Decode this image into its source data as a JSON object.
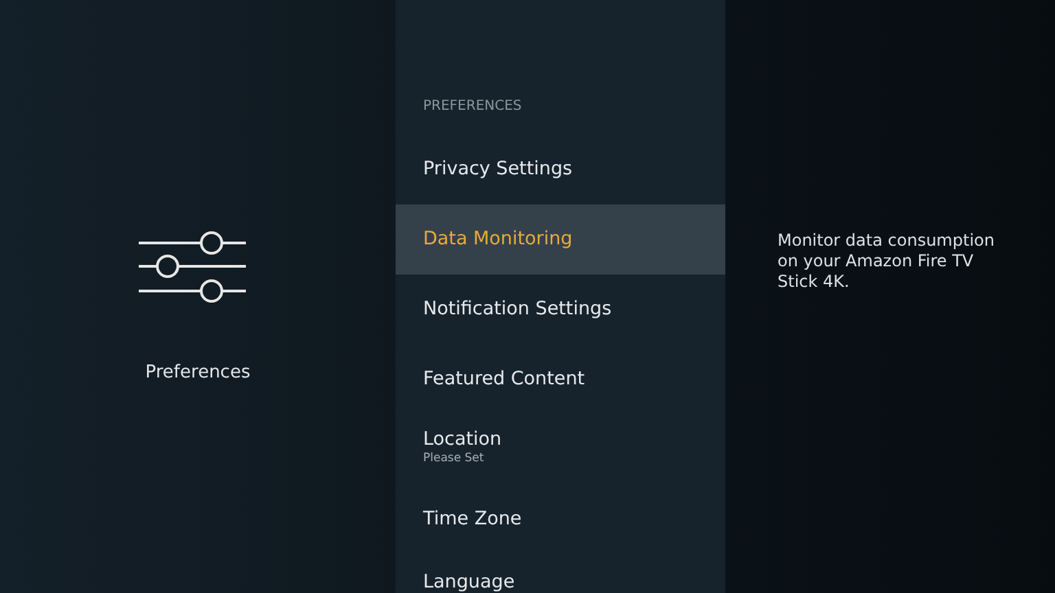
{
  "left_panel": {
    "title": "Preferences"
  },
  "menu": {
    "header": "PREFERENCES",
    "items": [
      {
        "label": "Privacy Settings",
        "selected": false
      },
      {
        "label": "Data Monitoring",
        "selected": true
      },
      {
        "label": "Notification Settings",
        "selected": false
      },
      {
        "label": "Featured Content",
        "selected": false
      },
      {
        "label": "Location",
        "subtitle": "Please Set",
        "selected": false
      },
      {
        "label": "Time Zone",
        "selected": false
      },
      {
        "label": "Language",
        "selected": false
      }
    ]
  },
  "description": "Monitor data consumption on your Amazon Fire TV Stick 4K."
}
